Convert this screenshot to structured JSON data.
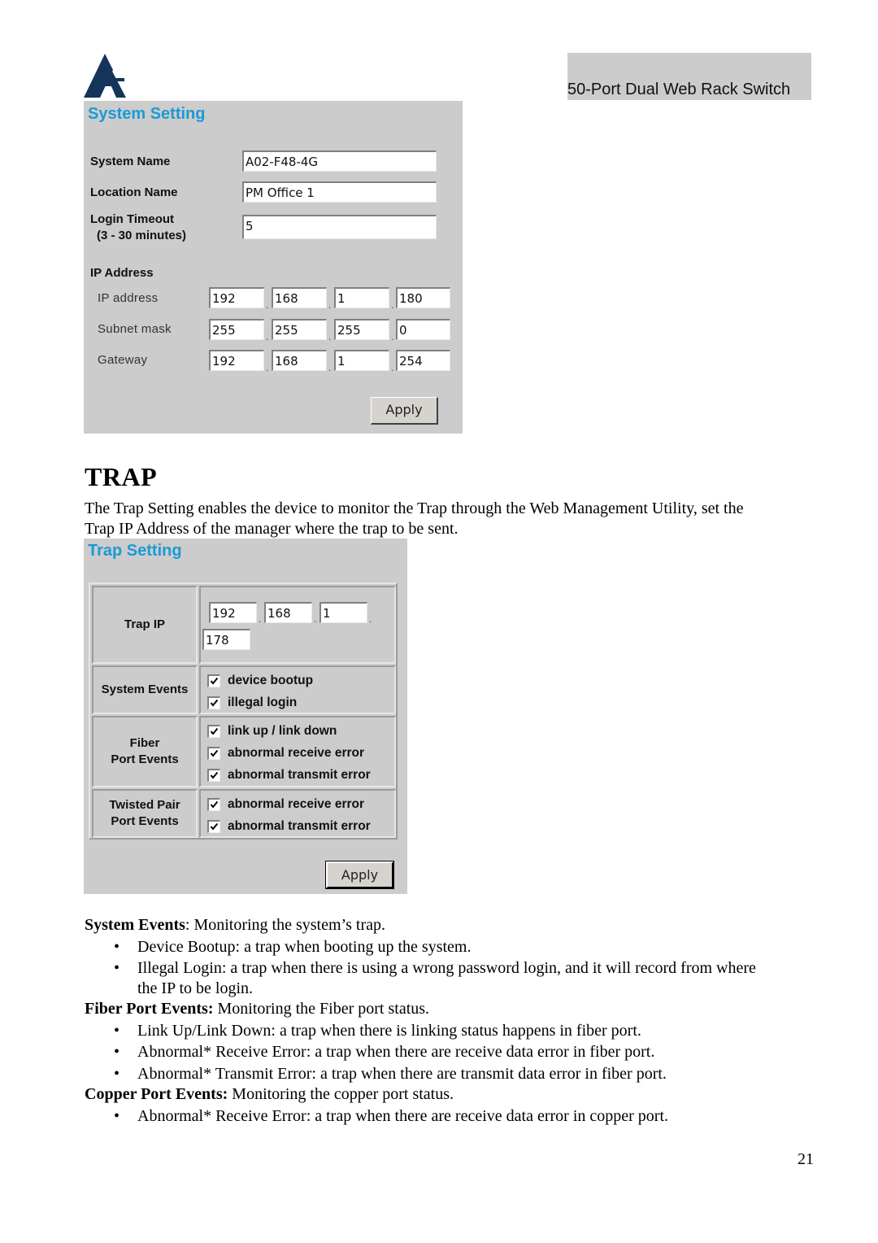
{
  "header": {
    "logo": "atlantis-logo-icon",
    "product_title": "50-Port Dual Web Rack Switch"
  },
  "system_setting": {
    "title": "System Setting",
    "system_name_label": "System Name",
    "system_name_value": "A02-F48-4G",
    "location_name_label": "Location Name",
    "location_name_value": "PM Office 1",
    "login_timeout_label": "Login Timeout",
    "login_timeout_hint": "(3 - 30 minutes)",
    "login_timeout_value": "5",
    "ip_section_label": "IP Address",
    "ip_rows": [
      {
        "label": "IP address",
        "octets": [
          "192",
          "168",
          "1",
          "180"
        ]
      },
      {
        "label": "Subnet mask",
        "octets": [
          "255",
          "255",
          "255",
          "0"
        ]
      },
      {
        "label": "Gateway",
        "octets": [
          "192",
          "168",
          "1",
          "254"
        ]
      }
    ],
    "apply_label": "Apply"
  },
  "trap_section": {
    "heading": "TRAP",
    "intro_line1": "The Trap Setting enables the device to monitor the Trap through the Web Management Utility, set the",
    "intro_line2": "Trap IP Address of the manager where the trap to be sent."
  },
  "trap_setting": {
    "title": "Trap Setting",
    "trap_ip_label": "Trap IP",
    "trap_ip_octets": [
      "192",
      "168",
      "1",
      "178"
    ],
    "groups": [
      {
        "label": "System Events",
        "items": [
          {
            "label": "device bootup",
            "checked": true
          },
          {
            "label": "illegal login",
            "checked": true
          }
        ]
      },
      {
        "label_line1": "Fiber",
        "label_line2": "Port Events",
        "items": [
          {
            "label": "link up / link down",
            "checked": true
          },
          {
            "label": "abnormal receive error",
            "checked": true
          },
          {
            "label": "abnormal transmit error",
            "checked": true
          }
        ]
      },
      {
        "label_line1": "Twisted Pair",
        "label_line2": "Port Events",
        "items": [
          {
            "label": "abnormal receive error",
            "checked": true
          },
          {
            "label": "abnormal transmit error",
            "checked": true
          }
        ]
      }
    ],
    "apply_label": "Apply"
  },
  "description": {
    "system_events_term": "System Events",
    "system_events_text": ": Monitoring the system’s trap.",
    "system_bullets": [
      "Device Bootup: a trap when booting up the system.",
      "Illegal Login: a trap when there is using a wrong password login, and it will record from where",
      "the IP to be login."
    ],
    "fiber_term": "Fiber Port Events:",
    "fiber_text": " Monitoring the Fiber port status.",
    "fiber_bullets": [
      "Link Up/Link Down: a trap when there is linking status happens in fiber port.",
      "Abnormal* Receive Error: a trap when there are receive data error in fiber port.",
      "Abnormal* Transmit Error: a trap when there are transmit data error in fiber port."
    ],
    "copper_term": "Copper Port Events:",
    "copper_text": " Monitoring the copper port status.",
    "copper_bullets": [
      "Abnormal* Receive Error: a trap when there are receive data error in copper port."
    ],
    "bullet_char": "•"
  },
  "footer": {
    "page_number": "21"
  }
}
